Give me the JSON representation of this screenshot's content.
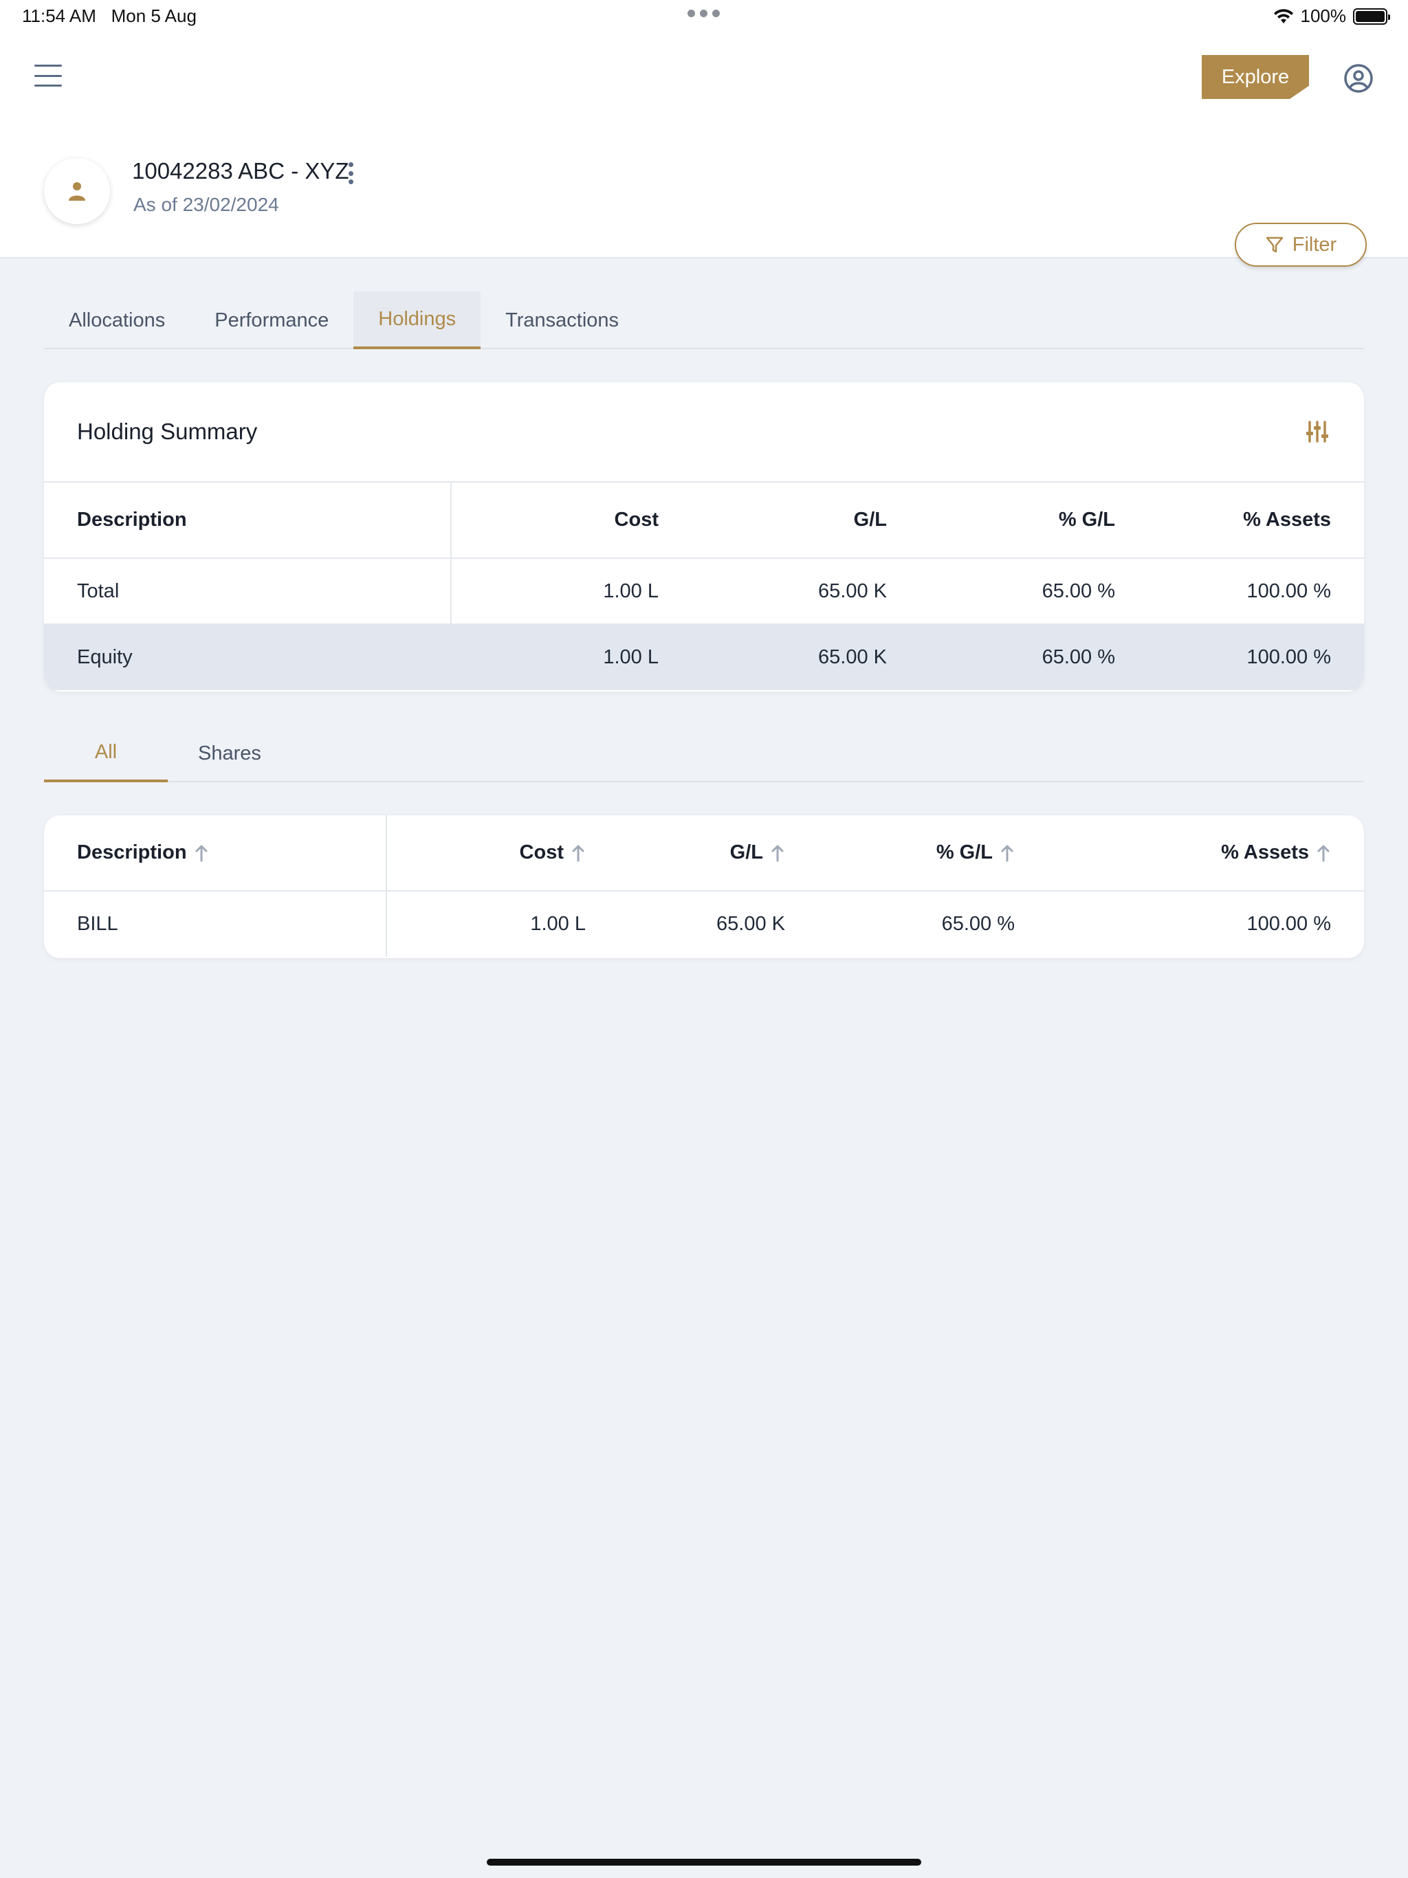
{
  "status_bar": {
    "time": "11:54 AM",
    "date": "Mon 5 Aug",
    "battery": "100%"
  },
  "header": {
    "explore_label": "Explore",
    "account_title": "10042283 ABC - XYZ",
    "as_of": "As of 23/02/2024",
    "filter_label": "Filter"
  },
  "tabs": [
    {
      "label": "Allocations",
      "active": false
    },
    {
      "label": "Performance",
      "active": false
    },
    {
      "label": "Holdings",
      "active": true
    },
    {
      "label": "Transactions",
      "active": false
    }
  ],
  "summary": {
    "title": "Holding Summary",
    "columns": [
      "Description",
      "Cost",
      "G/L",
      "% G/L",
      "% Assets"
    ],
    "rows": [
      [
        "Total",
        "1.00 L",
        "65.00 K",
        "65.00 %",
        "100.00 %"
      ],
      [
        "Equity",
        "1.00 L",
        "65.00 K",
        "65.00 %",
        "100.00 %"
      ]
    ]
  },
  "sub_tabs": [
    {
      "label": "All",
      "active": true
    },
    {
      "label": "Shares",
      "active": false
    }
  ],
  "holdings": {
    "columns": [
      "Description",
      "Cost",
      "G/L",
      "% G/L",
      "% Assets"
    ],
    "rows": [
      [
        "BILL",
        "1.00 L",
        "65.00 K",
        "65.00 %",
        "100.00 %"
      ]
    ]
  },
  "colors": {
    "accent": "#b08a4a",
    "background": "#eff2f7",
    "highlight_row": "#e2e7ef"
  },
  "icons": [
    "menu-icon",
    "user-circle-icon",
    "person-icon",
    "more-vertical-icon",
    "filter-icon",
    "sliders-icon",
    "sort-up-arrow-icon",
    "wifi-icon",
    "battery-icon"
  ]
}
